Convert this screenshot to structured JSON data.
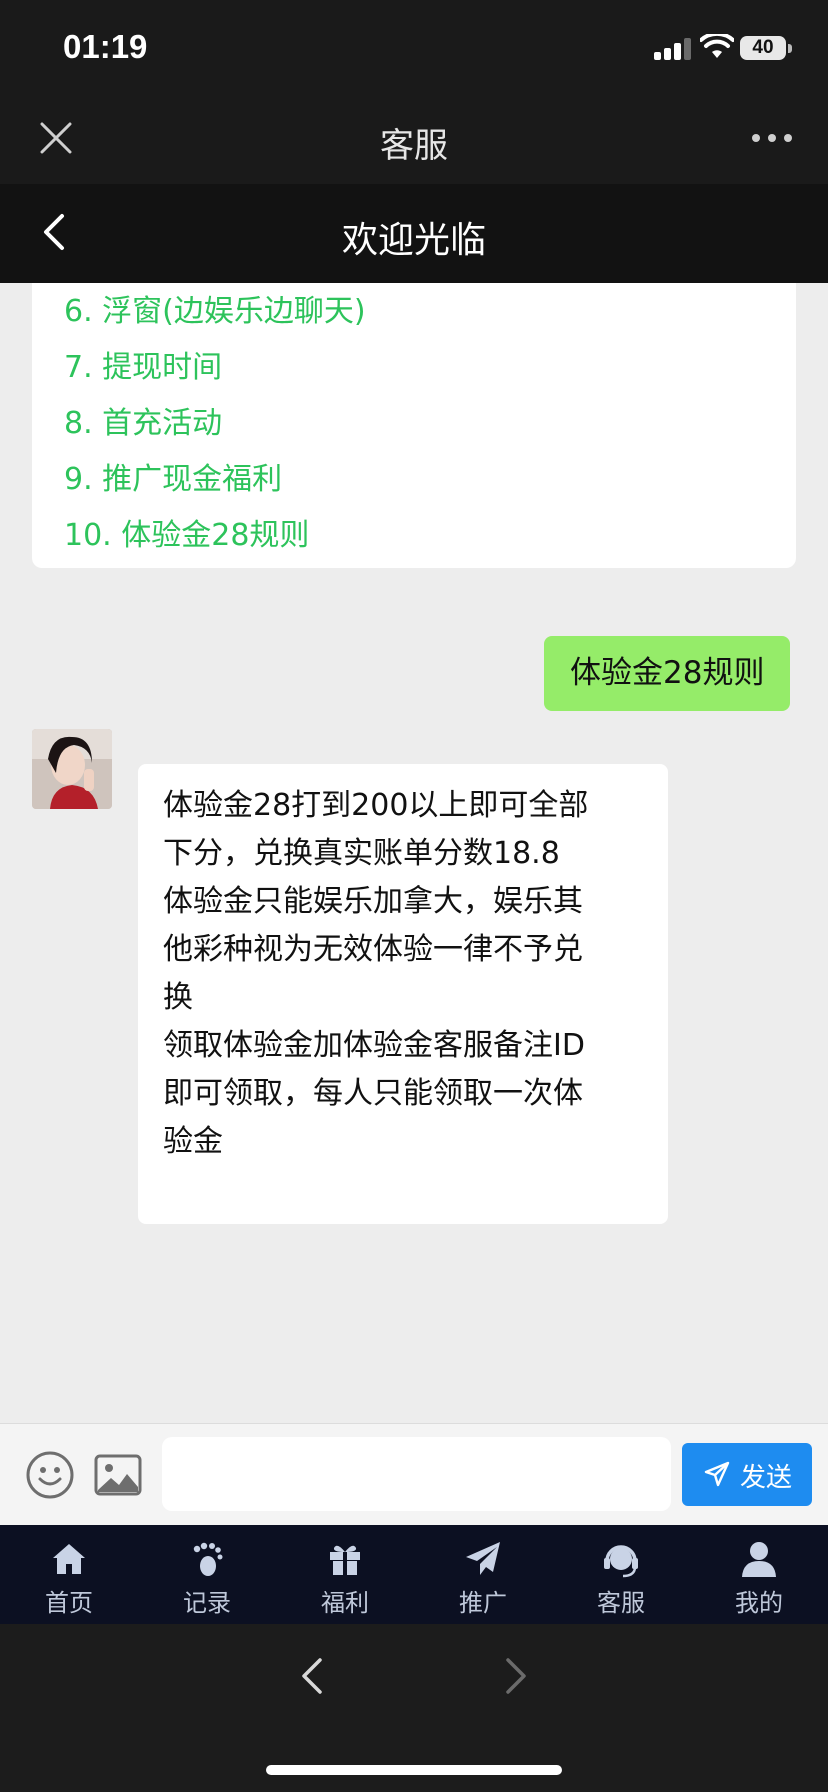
{
  "status": {
    "time": "01:19",
    "battery": "40"
  },
  "webview": {
    "title": "客服"
  },
  "header": {
    "title": "欢迎光临"
  },
  "menu": {
    "items": [
      "6. 浮窗(边娱乐边聊天)",
      "7. 提现时间",
      "8. 首充活动",
      "9. 推广现金福利",
      "10. 体验金28规则"
    ]
  },
  "messages": {
    "user": "体验金28规则",
    "reply_lines": [
      "体验金28打到200以上即可全部",
      "下分，兑换真实账单分数18.8",
      "体验金只能娱乐加拿大，娱乐其",
      "他彩种视为无效体验一律不予兑",
      "换",
      "领取体验金加体验金客服备注ID",
      "即可领取，每人只能领取一次体",
      "验金"
    ]
  },
  "input": {
    "value": "",
    "placeholder": "",
    "send_label": "发送"
  },
  "tabbar": {
    "tabs": [
      {
        "label": "首页",
        "icon": "home-icon"
      },
      {
        "label": "记录",
        "icon": "footprint-icon"
      },
      {
        "label": "福利",
        "icon": "gift-icon"
      },
      {
        "label": "推广",
        "icon": "paper-plane-icon"
      },
      {
        "label": "客服",
        "icon": "headset-icon"
      },
      {
        "label": "我的",
        "icon": "user-icon"
      }
    ]
  },
  "colors": {
    "menu_link": "#2dc35b",
    "user_bubble": "#95ec69",
    "send_button": "#1e8cf0",
    "tabbar_bg": "#0c1022"
  }
}
